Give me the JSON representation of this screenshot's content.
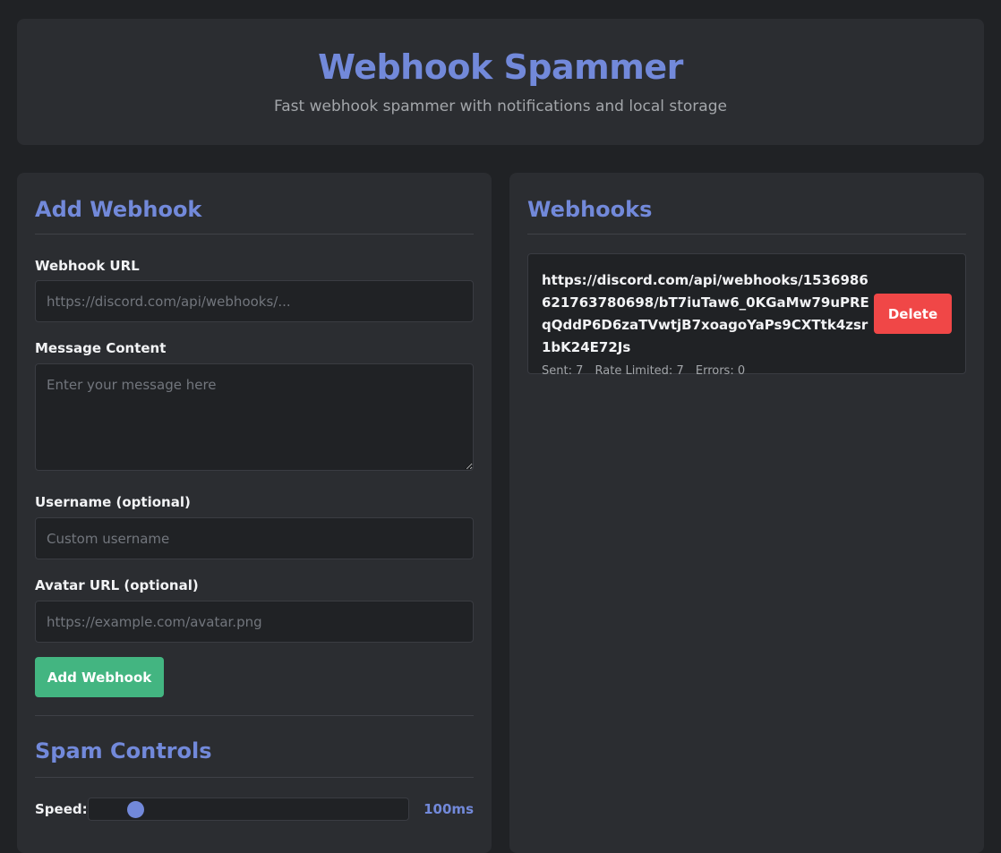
{
  "header": {
    "title": "Webhook Spammer",
    "subtitle": "Fast webhook spammer with notifications and local storage"
  },
  "add_webhook": {
    "title": "Add Webhook",
    "url_label": "Webhook URL",
    "url_placeholder": "https://discord.com/api/webhooks/...",
    "message_label": "Message Content",
    "message_placeholder": "Enter your message here",
    "username_label": "Username (optional)",
    "username_placeholder": "Custom username",
    "avatar_label": "Avatar URL (optional)",
    "avatar_placeholder": "https://example.com/avatar.png",
    "add_button": "Add Webhook"
  },
  "spam_controls": {
    "title": "Spam Controls",
    "speed_label": "Speed:",
    "speed_value": "100ms"
  },
  "webhooks": {
    "title": "Webhooks",
    "items": [
      {
        "url": "https://discord.com/api/webhooks/1536986621763780698/bT7iuTaw6_0KGaMw79uPREqQddP6D6zaTVwtjB7xoagoYaPs9CXTtk4zsr1bK24E72Js",
        "sent": "Sent: 7",
        "rate_limited": "Rate Limited: 7",
        "errors": "Errors: 0",
        "delete_label": "Delete"
      }
    ]
  },
  "colors": {
    "accent": "#7289da",
    "success": "#43b581",
    "danger": "#f04747",
    "background": "#202225",
    "panel": "#2b2d31"
  }
}
